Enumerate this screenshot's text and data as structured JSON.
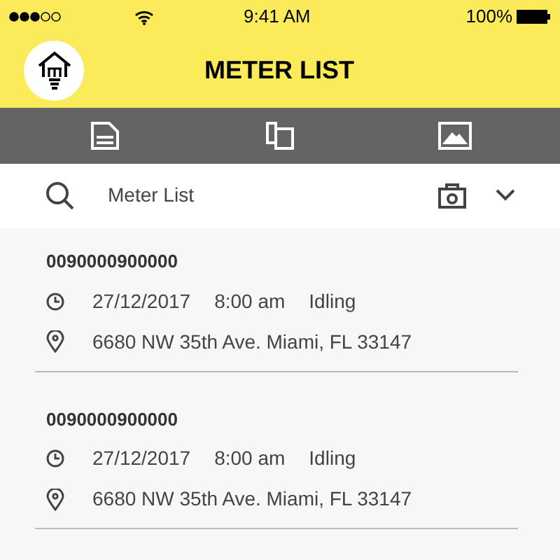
{
  "status_bar": {
    "time": "9:41 AM",
    "battery": "100%"
  },
  "header": {
    "title": "METER LIST"
  },
  "search": {
    "placeholder": "Meter List"
  },
  "meters": [
    {
      "number": "0090000900000",
      "date": "27/12/2017",
      "time": "8:00 am",
      "status": "Idling",
      "address": "6680 NW 35th Ave. Miami, FL 33147"
    },
    {
      "number": "0090000900000",
      "date": "27/12/2017",
      "time": "8:00 am",
      "status": "Idling",
      "address": "6680 NW 35th Ave. Miami, FL 33147"
    }
  ]
}
